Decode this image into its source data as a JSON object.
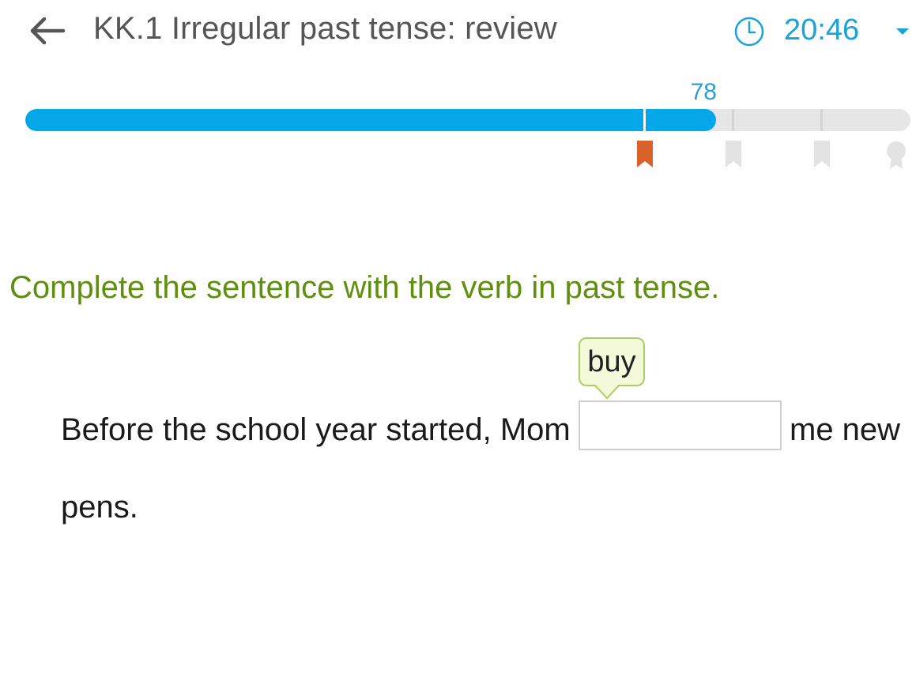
{
  "header": {
    "back_icon": "arrow-left-icon",
    "title": "KK.1 Irregular past tense: review",
    "clock_icon": "clock-icon",
    "timer": "20:46",
    "timer_toggle_icon": "caret-down-icon"
  },
  "progress": {
    "score": "78",
    "score_value": 78,
    "milestones": [
      70,
      80,
      90,
      100
    ],
    "milestone_icons": [
      "bookmark-icon",
      "bookmark-icon",
      "bookmark-icon",
      "award-ribbon-icon"
    ],
    "reached_milestones": 1
  },
  "question": {
    "prompt": "Complete the sentence with the verb in past tense.",
    "hint_word": "buy",
    "sentence_before": "Before the school year started, Mom",
    "sentence_after_inline": "me new",
    "sentence_end": "pens.",
    "answer_value": ""
  },
  "colors": {
    "accent_blue": "#05a7e8",
    "timer_blue": "#1aa3d9",
    "prompt_green": "#5e8f0e",
    "milestone_reached": "#d9622b",
    "milestone_pending": "#e3e3e3",
    "track_gray": "#e6e6e6"
  }
}
